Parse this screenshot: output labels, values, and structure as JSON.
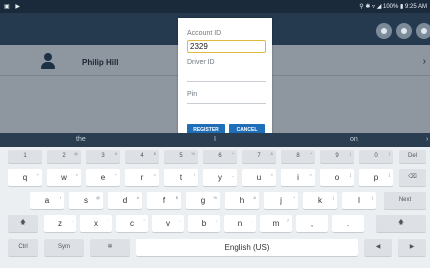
{
  "status": {
    "left_icons": "▣ ▶",
    "right_text": "⚲ ✱ ▿ ◢ 100% ▮ 9:25 AM"
  },
  "user_row": {
    "name": "Philip Hill"
  },
  "dialog": {
    "account_label": "Account ID",
    "account_value": "2329",
    "driver_label": "Driver ID",
    "pin_label": "Pin",
    "register_label": "REGISTER",
    "cancel_label": "CANCEL"
  },
  "keyboard": {
    "suggestions": [
      "the",
      "I",
      "on"
    ],
    "number_row": [
      {
        "k": "1",
        "s": ""
      },
      {
        "k": "2",
        "s": "@"
      },
      {
        "k": "3",
        "s": "#"
      },
      {
        "k": "4",
        "s": "$"
      },
      {
        "k": "5",
        "s": "%"
      },
      {
        "k": "6",
        "s": "^"
      },
      {
        "k": "7",
        "s": "&"
      },
      {
        "k": "8",
        "s": "*"
      },
      {
        "k": "9",
        "s": "("
      },
      {
        "k": "0",
        "s": ")"
      }
    ],
    "row1": [
      {
        "k": "q",
        "s": "+"
      },
      {
        "k": "w",
        "s": "×"
      },
      {
        "k": "e",
        "s": "÷"
      },
      {
        "k": "r",
        "s": "="
      },
      {
        "k": "t",
        "s": "/"
      },
      {
        "k": "y",
        "s": "_"
      },
      {
        "k": "u",
        "s": "<"
      },
      {
        "k": "i",
        "s": ">"
      },
      {
        "k": "o",
        "s": "["
      },
      {
        "k": "p",
        "s": "]"
      }
    ],
    "row2": [
      {
        "k": "a",
        "s": "!"
      },
      {
        "k": "s",
        "s": "@"
      },
      {
        "k": "d",
        "s": "#"
      },
      {
        "k": "f",
        "s": "$"
      },
      {
        "k": "g",
        "s": "%"
      },
      {
        "k": "h",
        "s": "&"
      },
      {
        "k": "j",
        "s": "*"
      },
      {
        "k": "k",
        "s": "("
      },
      {
        "k": "l",
        "s": ")"
      }
    ],
    "row3": [
      {
        "k": "z",
        "s": "-"
      },
      {
        "k": "x",
        "s": "'"
      },
      {
        "k": "c",
        "s": "\""
      },
      {
        "k": "v",
        "s": ":"
      },
      {
        "k": "b",
        "s": ";"
      },
      {
        "k": "n",
        "s": ","
      },
      {
        "k": "m",
        "s": "?"
      },
      {
        "k": ",",
        "s": ""
      },
      {
        "k": ".",
        "s": ""
      }
    ],
    "del_label": "Del",
    "next_label": "Next",
    "ctrl_label": "Ctrl",
    "sym_label": "Sym",
    "space_label": "English (US)",
    "shift_glyph": "🡅",
    "backspace_glyph": "⌫",
    "settings_glyph": "✲",
    "left_glyph": "◀",
    "right_glyph": "▶",
    "question_mark": "?"
  }
}
